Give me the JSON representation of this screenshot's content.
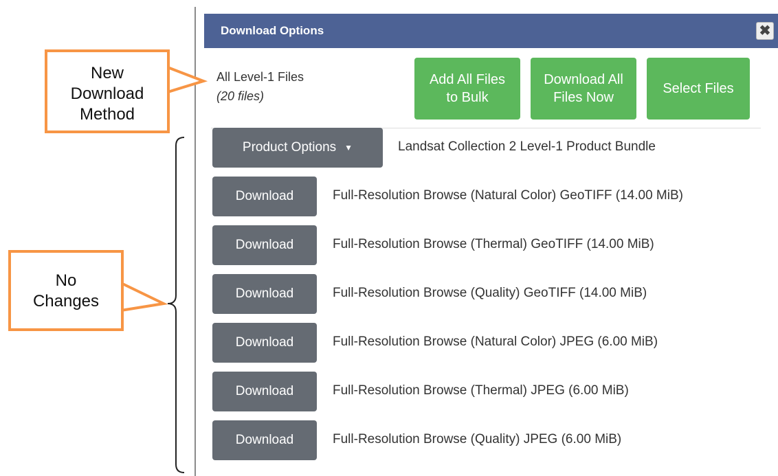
{
  "dialog": {
    "title": "Download Options",
    "close_icon": "close-icon",
    "close_glyph": "✖",
    "all_files": {
      "label": "All Level-1 Files",
      "count": "(20 files)"
    },
    "buttons": {
      "add_bulk": [
        "Add All Files",
        "to Bulk"
      ],
      "download_all": [
        "Download All",
        "Files Now"
      ],
      "select_files": "Select Files"
    },
    "product_options_label": "Product Options",
    "product_bundle_label": "Landsat Collection 2 Level-1 Product Bundle",
    "download_label": "Download",
    "files": [
      "Full-Resolution Browse (Natural Color) GeoTIFF (14.00 MiB)",
      "Full-Resolution Browse (Thermal) GeoTIFF (14.00 MiB)",
      "Full-Resolution Browse (Quality) GeoTIFF (14.00 MiB)",
      "Full-Resolution Browse (Natural Color) JPEG (6.00 MiB)",
      "Full-Resolution Browse (Thermal) JPEG (6.00 MiB)",
      "Full-Resolution Browse (Quality) JPEG (6.00 MiB)"
    ]
  },
  "annotations": {
    "new_method": [
      "New",
      "Download",
      "Method"
    ],
    "no_changes": [
      "No",
      "Changes"
    ]
  },
  "colors": {
    "title_bar": "#4d6295",
    "green_button": "#5cb85c",
    "gray_button": "#656b73",
    "callout_border": "#f79545"
  }
}
